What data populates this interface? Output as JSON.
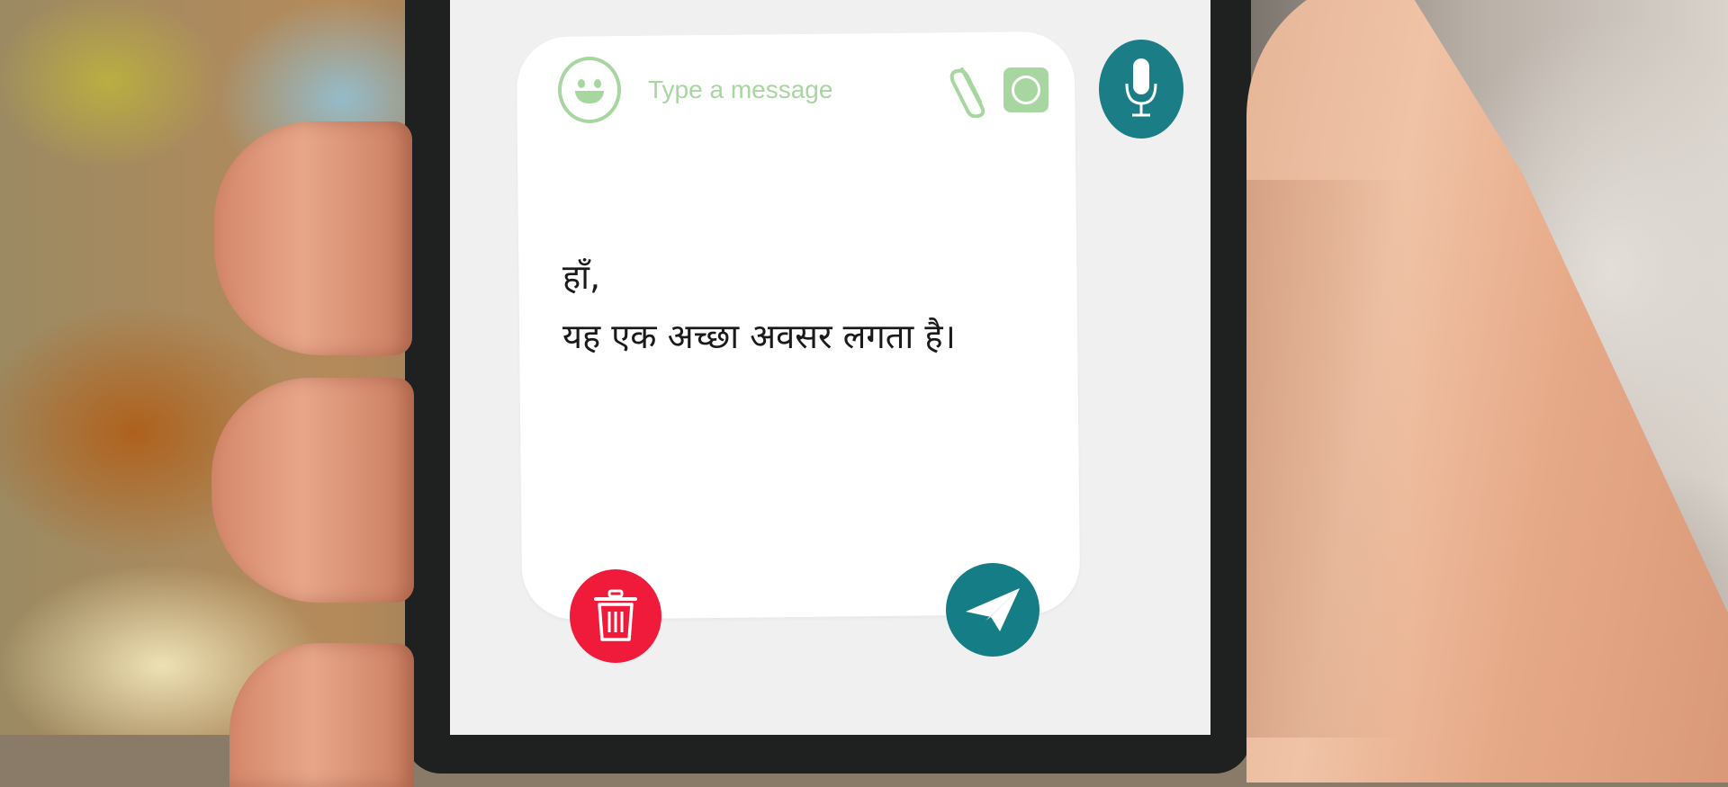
{
  "composer": {
    "placeholder": "Type a message",
    "icons": {
      "emoji": "smiley-face-icon",
      "attach": "paperclip-icon",
      "camera": "camera-icon",
      "mic": "microphone-icon",
      "delete": "trash-icon",
      "send": "paper-plane-icon"
    }
  },
  "message": {
    "lines": [
      "हाँ,",
      "यह एक अच्छा अवसर लगता है।"
    ]
  },
  "colors": {
    "accent_green": "#a7d6a0",
    "teal": "#1b7d86",
    "delete_red": "#f01b3b",
    "card": "#ffffff",
    "screen": "#f0f0f0"
  }
}
